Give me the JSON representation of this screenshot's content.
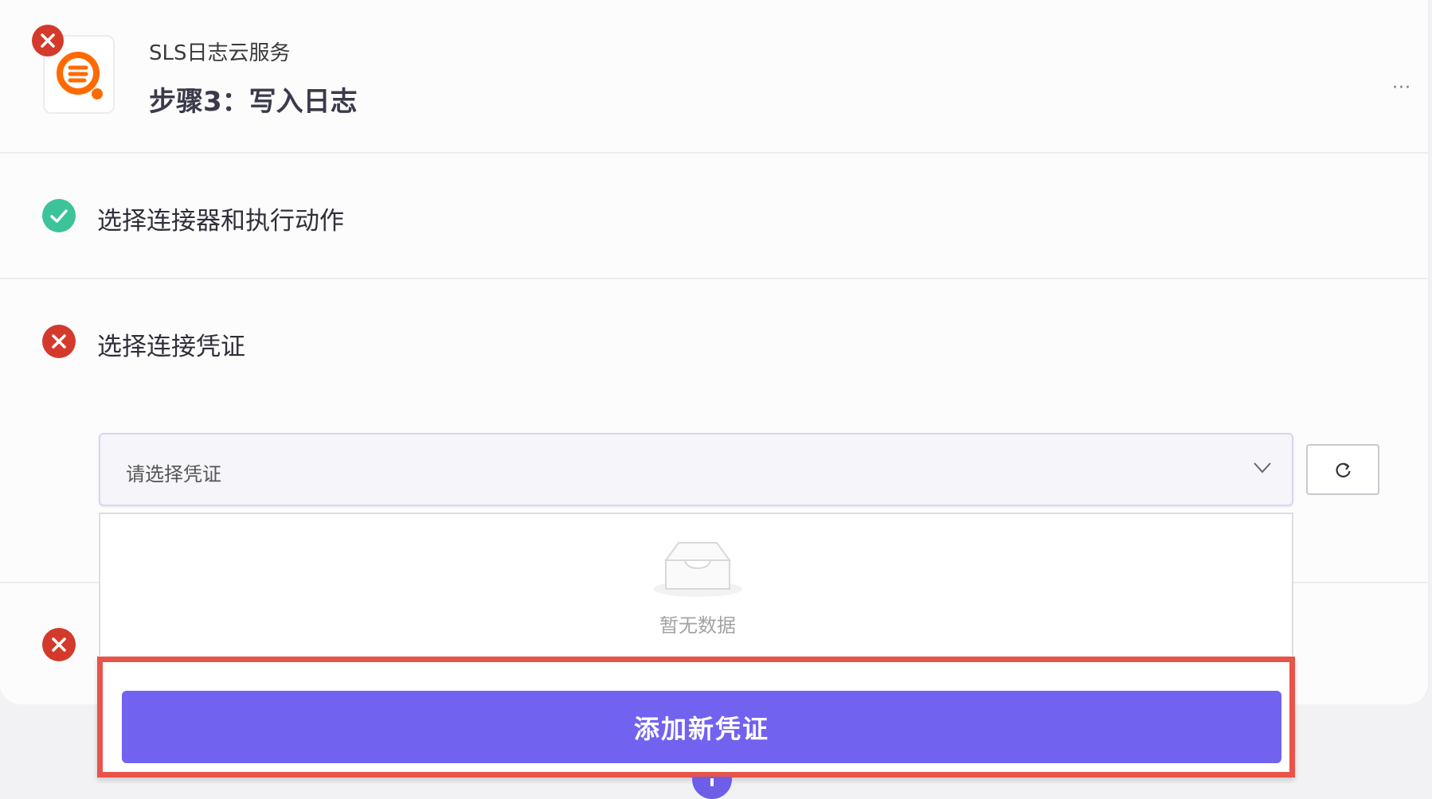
{
  "header": {
    "app_name": "SLS日志云服务",
    "step_title": "步骤3：写入日志",
    "more_label": "···"
  },
  "sections": [
    {
      "label": "选择连接器和执行动作",
      "status": "success"
    },
    {
      "label": "选择连接凭证",
      "status": "error"
    },
    {
      "label": "",
      "status": "error"
    }
  ],
  "credential_select": {
    "placeholder": "请选择凭证"
  },
  "dropdown": {
    "empty_text": "暂无数据",
    "add_button_label": "添加新凭证"
  },
  "colors": {
    "accent": "#7262f0",
    "success": "#3cc39a",
    "error": "#d33a2c",
    "highlight": "#e8544a",
    "app_icon": "#ff6a00"
  },
  "icons": {
    "app": "log-search-icon",
    "success": "check-circle-icon",
    "error": "close-circle-icon",
    "select_arrow": "chevron-down-icon",
    "refresh": "refresh-icon",
    "empty": "empty-inbox-icon"
  }
}
